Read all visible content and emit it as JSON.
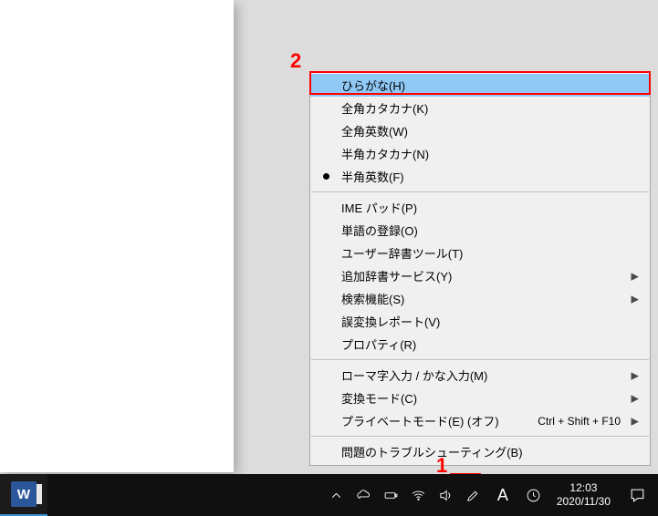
{
  "annotations": {
    "label1": "1",
    "label2": "2"
  },
  "menu": {
    "groups": [
      [
        {
          "label": "ひらがな(H)",
          "highlighted": true
        },
        {
          "label": "全角カタカナ(K)"
        },
        {
          "label": "全角英数(W)"
        },
        {
          "label": "半角カタカナ(N)"
        },
        {
          "label": "半角英数(F)",
          "selected": true
        }
      ],
      [
        {
          "label": "IME パッド(P)"
        },
        {
          "label": "単語の登録(O)"
        },
        {
          "label": "ユーザー辞書ツール(T)"
        },
        {
          "label": "追加辞書サービス(Y)",
          "submenu": true
        },
        {
          "label": "検索機能(S)",
          "submenu": true
        },
        {
          "label": "誤変換レポート(V)"
        },
        {
          "label": "プロパティ(R)"
        }
      ],
      [
        {
          "label": "ローマ字入力 / かな入力(M)",
          "submenu": true
        },
        {
          "label": "変換モード(C)",
          "submenu": true
        },
        {
          "label": "プライベートモード(E) (オフ)",
          "shortcut": "Ctrl + Shift + F10",
          "submenu": true
        }
      ],
      [
        {
          "label": "問題のトラブルシューティング(B)"
        }
      ]
    ]
  },
  "taskbar": {
    "word_glyph": "W",
    "ime_glyph": "A",
    "time": "12:03",
    "date": "2020/11/30"
  }
}
